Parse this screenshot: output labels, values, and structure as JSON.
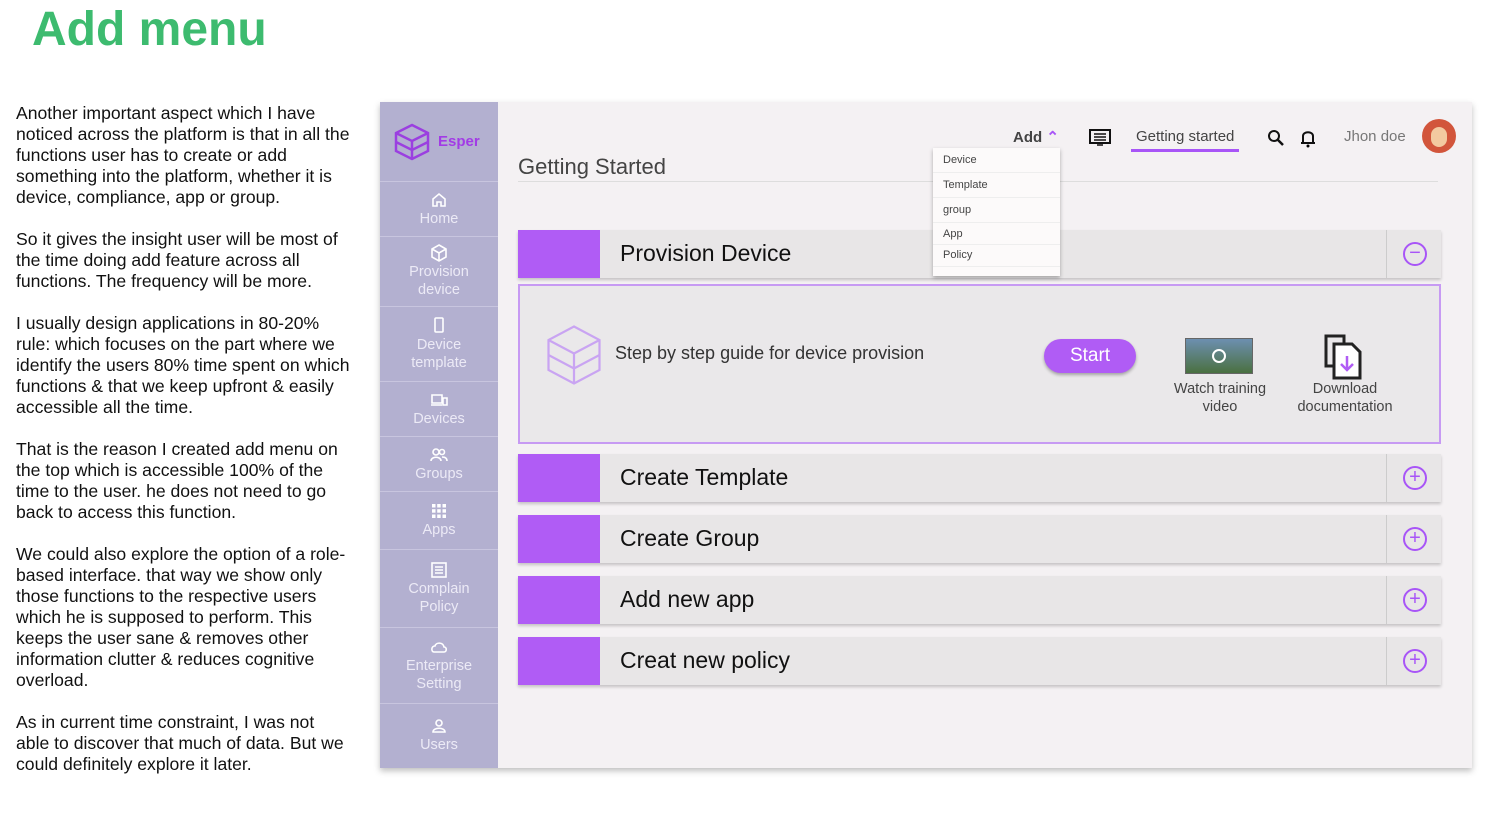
{
  "heading": "Add menu",
  "paragraphs": [
    "Another important aspect which I have noticed across the platform is that in all the functions user has to create or add something into the platform, whether it is device, compliance, app or group.",
    "So it gives the insight user will be most of the time doing add feature across all functions. The frequency will be more.",
    "I usually design applications in 80-20% rule: which focuses on the part where we identify the users 80% time spent on which functions & that we keep upfront & easily accessible all the time.",
    "That is the reason I created add menu on the top which is accessible 100% of the time to the user. he does not need to go back to access this function.",
    "We could also explore the option of a role-based interface. that way we show only those functions to the respective users which he is supposed to perform. This keeps the user sane & removes other information clutter & reduces cognitive overload.",
    "As in current time constraint, I was not able to discover that much of data. But we could definitely explore it later."
  ],
  "app": {
    "brand": "Esper",
    "sidebar": [
      {
        "label": "Home",
        "icon": "home-icon"
      },
      {
        "label": "Provision device",
        "icon": "cube-icon"
      },
      {
        "label": "Device template",
        "icon": "phone-icon"
      },
      {
        "label": "Devices",
        "icon": "devices-icon"
      },
      {
        "label": "Groups",
        "icon": "users-icon"
      },
      {
        "label": "Apps",
        "icon": "grid-icon"
      },
      {
        "label": "Complain Policy",
        "icon": "document-icon"
      },
      {
        "label": "Enterprise Setting",
        "icon": "cloud-icon"
      },
      {
        "label": "Users",
        "icon": "user-icon"
      }
    ],
    "header": {
      "add": "Add",
      "getting_started": "Getting started",
      "user": "Jhon doe"
    },
    "add_menu": [
      "Device",
      "Template",
      "group",
      "App",
      "Policy"
    ],
    "page_title": "Getting Started",
    "rows": [
      "Provision Device",
      "Create Template",
      "Create Group",
      "Add new app",
      "Creat new policy"
    ],
    "panel": {
      "guide": "Step by step guide for device provision",
      "start": "Start",
      "video": "Watch training video",
      "docs": "Download documentation"
    },
    "accent": "#b05cf5"
  }
}
